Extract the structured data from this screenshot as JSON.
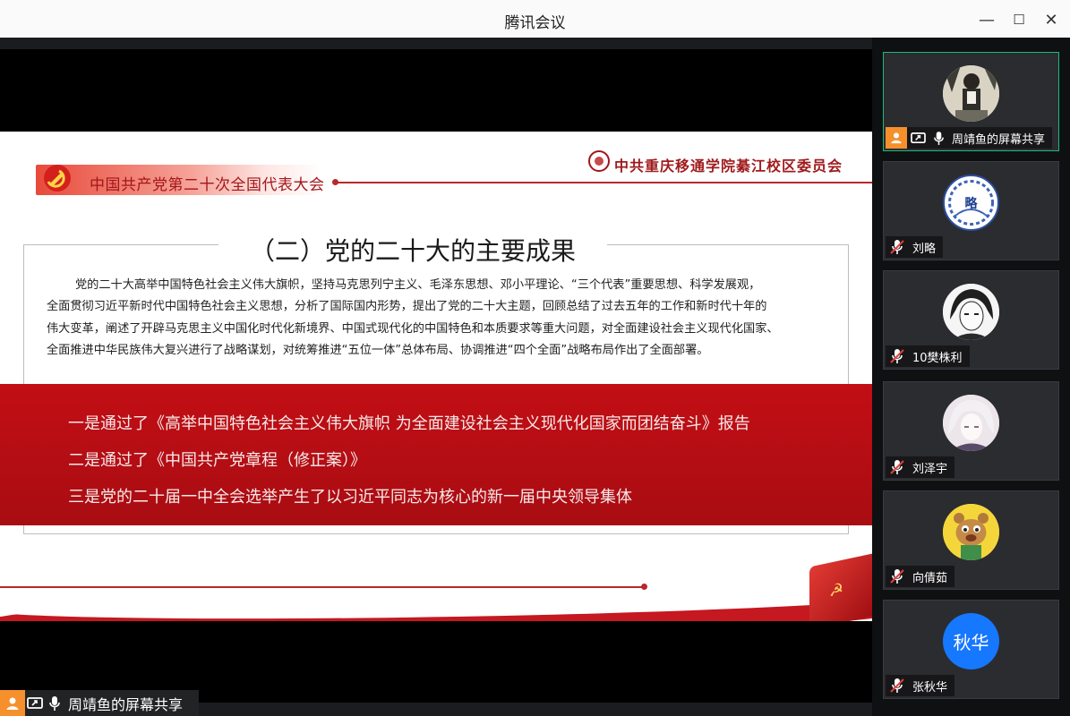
{
  "window": {
    "title": "腾讯会议",
    "minimize_glyph": "—",
    "maximize_glyph": "☐",
    "close_glyph": "✕"
  },
  "slide": {
    "congress_title": "中国共产党第二十次全国代表大会",
    "org_title": "中共重庆移通学院綦江校区委员会",
    "section_title": "（二）党的二十大的主要成果",
    "paragraph": [
      "党的二十大高举中国特色社会主义伟大旗帜，坚持马克思列宁主义、毛泽东思想、邓小平理论、“三个代表”重要思想、科学发展观，",
      "全面贯彻习近平新时代中国特色社会主义思想，分析了国际国内形势，提出了党的二十大主题，回顾总结了过去五年的工作和新时代十年的",
      "伟大变革，阐述了开辟马克思主义中国化时代化新境界、中国式现代化的中国特色和本质要求等重大问题，对全面建设社会主义现代化国家、",
      "全面推进中华民族伟大复兴进行了战略谋划，对统筹推进“五位一体”总体布局、协调推进“四个全面”战略布局作出了全面部署。"
    ],
    "points": [
      "一是通过了《高举中国特色社会主义伟大旗帜  为全面建设社会主义现代化国家而团结奋斗》报告",
      "二是通过了《中国共产党章程（修正案）》",
      "三是党的二十届一中全会选举产生了以习近平同志为核心的新一届中央领导集体"
    ]
  },
  "presenter": {
    "name": "周靖鱼的屏幕共享"
  },
  "participants": [
    {
      "name": "周靖鱼的屏幕共享",
      "avatar_icon": "photo-avatar-icon",
      "mic": "on",
      "active": true,
      "sharing": true
    },
    {
      "name": "刘略",
      "avatar_text": "略",
      "avatar_icon": "porcelain-avatar-icon",
      "mic": "muted"
    },
    {
      "name": "10樊株利",
      "avatar_icon": "anime-avatar-icon",
      "mic": "muted"
    },
    {
      "name": "刘泽宇",
      "avatar_icon": "anime-avatar-icon",
      "mic": "muted"
    },
    {
      "name": "向倩茹",
      "avatar_icon": "cartoon-avatar-icon",
      "mic": "muted"
    },
    {
      "name": "张秋华",
      "avatar_text": "秋华",
      "avatar_icon": "initials-avatar-icon",
      "mic": "muted"
    }
  ],
  "colors": {
    "accent_orange": "#f6902c",
    "active_border": "#1fb97a",
    "slide_red": "#c20e15",
    "muted_red": "#e3413b",
    "initials_blue": "#1677ff"
  }
}
